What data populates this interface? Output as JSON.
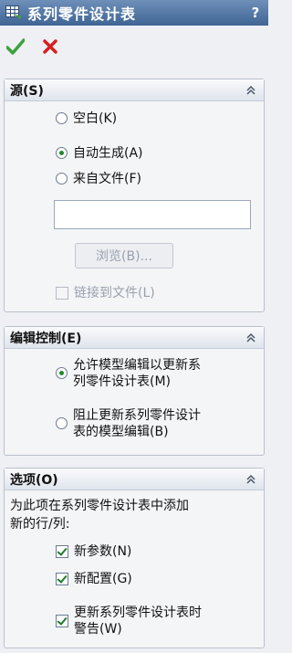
{
  "window": {
    "title": "系列零件设计表",
    "help": "?"
  },
  "actions": {
    "ok": "ok-checkmark",
    "cancel": "cancel-x"
  },
  "source": {
    "header": "源(S)",
    "options": [
      {
        "label": "空白(K)",
        "selected": false
      },
      {
        "label": "自动生成(A)",
        "selected": true
      },
      {
        "label": "来自文件(F)",
        "selected": false
      }
    ],
    "file_value": "",
    "browse_label": "浏览(B)...",
    "link_label": "链接到文件(L)",
    "link_checked": false
  },
  "edit_control": {
    "header": "编辑控制(E)",
    "options": [
      {
        "line1": "允许模型编辑以更新系",
        "line2": "列零件设计表(M)",
        "selected": true
      },
      {
        "line1": "阻止更新系列零件设计",
        "line2": "表的模型编辑(B)",
        "selected": false
      }
    ]
  },
  "options": {
    "header": "选项(O)",
    "description_line1": "为此项在系列零件设计表中添加",
    "description_line2": "新的行/列:",
    "checkboxes": [
      {
        "line1": "新参数(N)",
        "checked": true
      },
      {
        "line1": "新配置(G)",
        "checked": true
      },
      {
        "line1": "更新系列零件设计表时",
        "line2": "警告(W)",
        "checked": true
      }
    ]
  },
  "colors": {
    "title_bar": "#3f6594",
    "ok": "#3aa33a",
    "cancel": "#d62020",
    "radio_dot": "#1f8a2a"
  }
}
